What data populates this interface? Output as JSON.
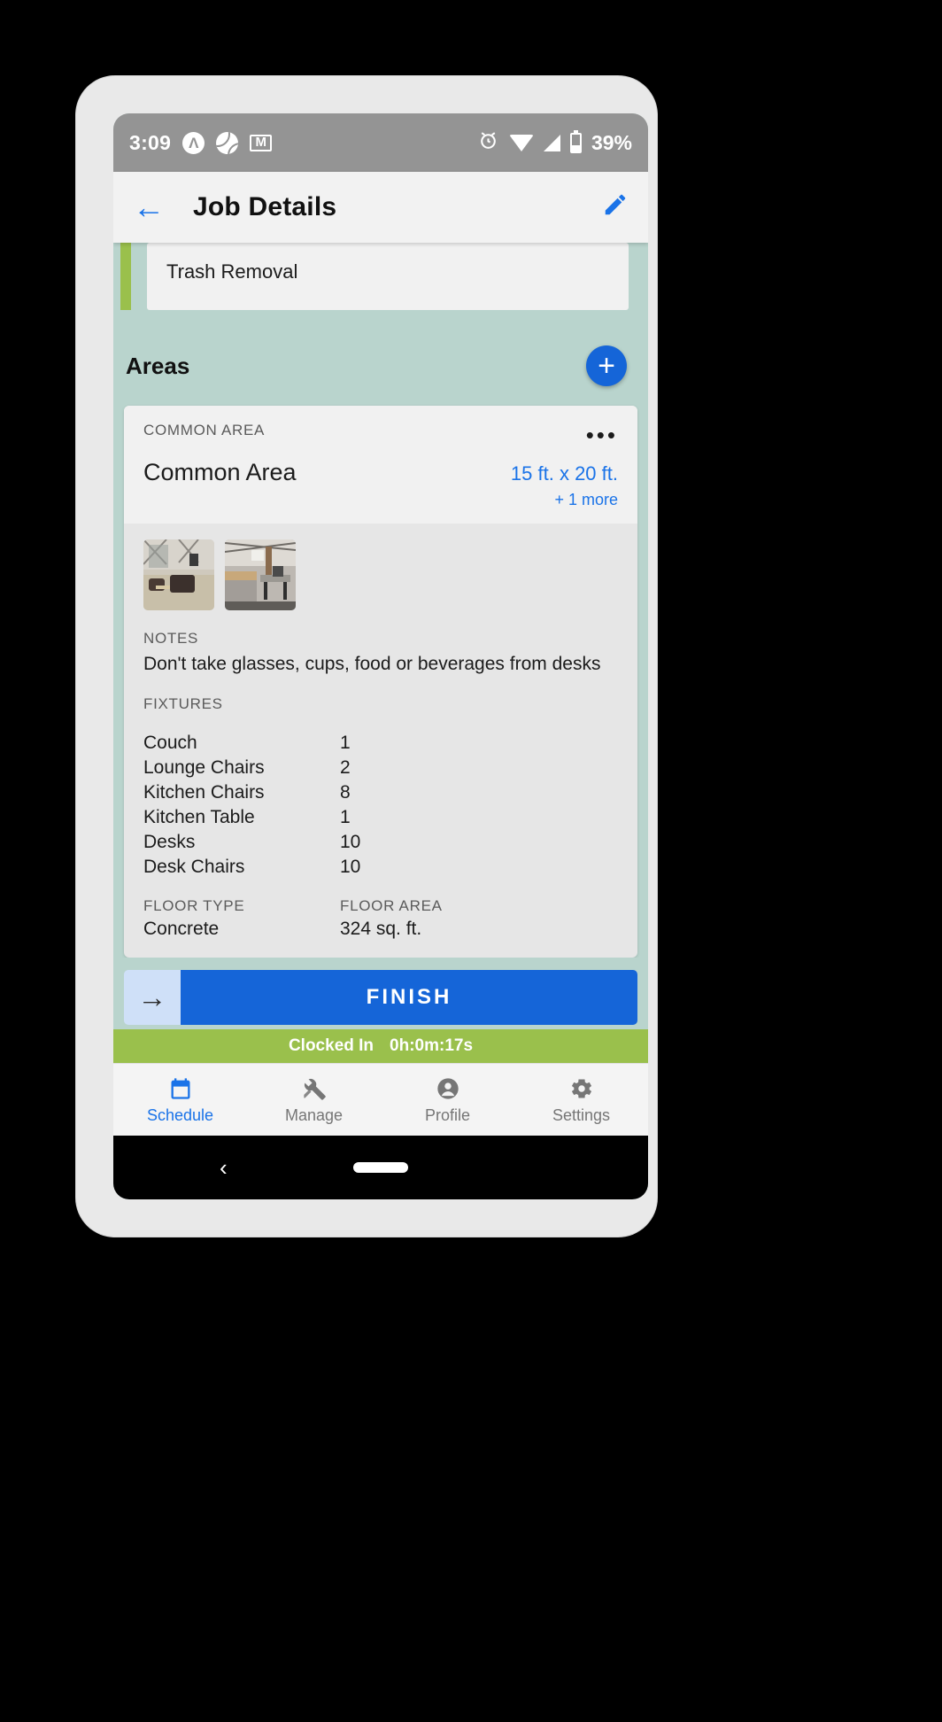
{
  "status_bar": {
    "time": "3:09",
    "battery_percent": "39%",
    "icons_left": [
      "app-circle-icon",
      "sports-ball-icon",
      "gmail-icon"
    ],
    "icons_right": [
      "alarm-icon",
      "wifi-icon",
      "cell-signal-icon",
      "battery-icon"
    ]
  },
  "app_bar": {
    "back_label": "←",
    "title": "Job Details",
    "edit_label": "✎"
  },
  "task": {
    "name": "Trash Removal"
  },
  "areas_section": {
    "title": "Areas",
    "add_label": "+"
  },
  "area_card": {
    "kicker": "COMMON AREA",
    "name": "Common Area",
    "overflow_label": "•••",
    "dimensions": "15 ft. x 20 ft.",
    "more_label": "+ 1 more",
    "photos": [
      "lounge-photo",
      "kitchen-photo"
    ],
    "notes_label": "NOTES",
    "notes_text": "Don't take glasses, cups, food or beverages from desks",
    "fixtures_label": "FIXTURES",
    "fixtures": [
      {
        "name": "Couch",
        "qty": "1"
      },
      {
        "name": "Lounge Chairs",
        "qty": "2"
      },
      {
        "name": "Kitchen Chairs",
        "qty": "8"
      },
      {
        "name": "Kitchen Table",
        "qty": "1"
      },
      {
        "name": "Desks",
        "qty": "10"
      },
      {
        "name": "Desk Chairs",
        "qty": "10"
      }
    ],
    "floor_type_label": "FLOOR TYPE",
    "floor_type_value": "Concrete",
    "floor_area_label": "FLOOR AREA",
    "floor_area_value": "324 sq. ft."
  },
  "action_bar": {
    "next_label": "→",
    "finish_label": "FINISH"
  },
  "clocked_banner": {
    "status": "Clocked In",
    "elapsed": "0h:0m:17s"
  },
  "bottom_nav": [
    {
      "label": "Schedule",
      "icon": "calendar-icon"
    },
    {
      "label": "Manage",
      "icon": "tools-icon"
    },
    {
      "label": "Profile",
      "icon": "person-icon"
    },
    {
      "label": "Settings",
      "icon": "gear-icon"
    }
  ],
  "android_nav": {
    "back_label": "‹"
  },
  "colors": {
    "accent_blue": "#1565d8",
    "link_blue": "#1a73e8",
    "green": "#9ac04c",
    "page_bg": "#b9d4cd"
  }
}
